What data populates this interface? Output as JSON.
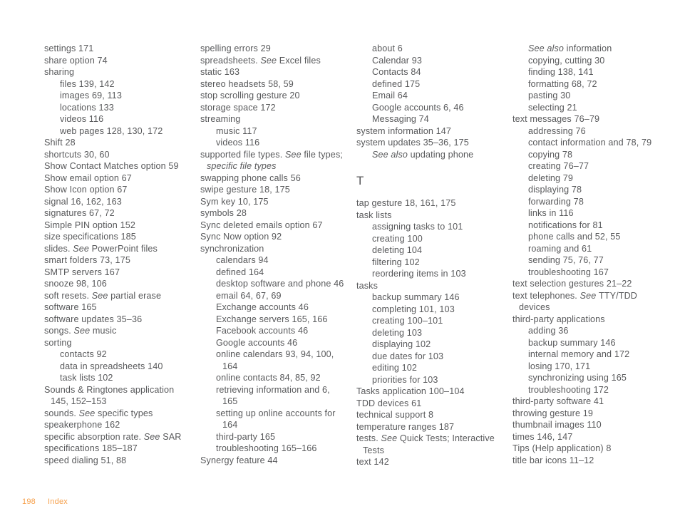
{
  "page": {
    "title": "Index",
    "folio_number": "198",
    "folio_label": "Index",
    "accent_color": "#f6a04b",
    "text_color": "#58595b",
    "background_color": "#ffffff"
  },
  "columns": [
    {
      "id": "column-1",
      "entries": [
        {
          "level": 0,
          "text": "settings 171"
        },
        {
          "level": 0,
          "text": "share option 74"
        },
        {
          "level": 0,
          "text": "sharing"
        },
        {
          "level": 1,
          "text": "files 139, 142"
        },
        {
          "level": 1,
          "text": "images 69, 113"
        },
        {
          "level": 1,
          "text": "locations 133"
        },
        {
          "level": 1,
          "text": "videos 116"
        },
        {
          "level": 1,
          "text": "web pages 128, 130, 172"
        },
        {
          "level": 0,
          "text": "Shift 28"
        },
        {
          "level": 0,
          "text": "shortcuts 30, 60"
        },
        {
          "level": 0,
          "text": "Show Contact Matches option 59"
        },
        {
          "level": 0,
          "text": "Show email option 67"
        },
        {
          "level": 0,
          "text": "Show Icon option 67"
        },
        {
          "level": 0,
          "text": "signal 16, 162, 163"
        },
        {
          "level": 0,
          "text": "signatures 67, 72"
        },
        {
          "level": 0,
          "text": "Simple PIN option 152"
        },
        {
          "level": 0,
          "text": "size specifications 185"
        },
        {
          "level": 0,
          "text": "slides. ",
          "italic_part": "See ",
          "tail": "PowerPoint files"
        },
        {
          "level": 0,
          "text": "smart folders 73, 175"
        },
        {
          "level": 0,
          "text": "SMTP servers 167"
        },
        {
          "level": 0,
          "text": "snooze 98, 106"
        },
        {
          "level": 0,
          "text": "soft resets. ",
          "italic_part": "See ",
          "tail": "partial erase"
        },
        {
          "level": 0,
          "text": "software 165"
        },
        {
          "level": 0,
          "text": "software updates 35–36"
        },
        {
          "level": 0,
          "text": "songs. ",
          "italic_part": "See ",
          "tail": "music"
        },
        {
          "level": 0,
          "text": "sorting"
        },
        {
          "level": 1,
          "text": "contacts 92"
        },
        {
          "level": 1,
          "text": "data in spreadsheets 140"
        },
        {
          "level": 1,
          "text": "task lists 102"
        },
        {
          "level": 0,
          "text": "Sounds & Ringtones application"
        },
        {
          "level": 0,
          "wrap": true,
          "text": "145, 152–153"
        },
        {
          "level": 0,
          "text": "sounds. ",
          "italic_part": "See ",
          "tail": "specific types"
        },
        {
          "level": 0,
          "text": "speakerphone 162"
        },
        {
          "level": 0,
          "text": "specific absorption rate. ",
          "italic_part": "See ",
          "tail": "SAR"
        },
        {
          "level": 0,
          "text": "specifications 185–187"
        },
        {
          "level": 0,
          "text": "speed dialing 51, 88"
        }
      ]
    },
    {
      "id": "column-2",
      "entries": [
        {
          "level": 0,
          "text": "spelling errors 29"
        },
        {
          "level": 0,
          "text": "spreadsheets. ",
          "italic_part": "See ",
          "tail": "Excel files"
        },
        {
          "level": 0,
          "text": "static 163"
        },
        {
          "level": 0,
          "text": "stereo headsets 58, 59"
        },
        {
          "level": 0,
          "text": "stop scrolling gesture 20"
        },
        {
          "level": 0,
          "text": "storage space 172"
        },
        {
          "level": 0,
          "text": "streaming"
        },
        {
          "level": 1,
          "text": "music 117"
        },
        {
          "level": 1,
          "text": "videos 116"
        },
        {
          "level": 0,
          "text": "supported file types. ",
          "italic_part": "See ",
          "tail": "file types;"
        },
        {
          "level": 0,
          "wrap": true,
          "italic_full": true,
          "text": "specific file types"
        },
        {
          "level": 0,
          "text": "swapping phone calls 56"
        },
        {
          "level": 0,
          "text": "swipe gesture 18, 175"
        },
        {
          "level": 0,
          "text": "Sym key 10, 175"
        },
        {
          "level": 0,
          "text": "symbols 28"
        },
        {
          "level": 0,
          "text": "Sync deleted emails option 67"
        },
        {
          "level": 0,
          "text": "Sync Now option 92"
        },
        {
          "level": 0,
          "text": "synchronization"
        },
        {
          "level": 1,
          "text": "calendars 94"
        },
        {
          "level": 1,
          "text": "defined 164"
        },
        {
          "level": 1,
          "text": "desktop software and phone 46"
        },
        {
          "level": 1,
          "text": "email 64, 67, 69"
        },
        {
          "level": 1,
          "text": "Exchange accounts 46"
        },
        {
          "level": 1,
          "text": "Exchange servers 165, 166"
        },
        {
          "level": 1,
          "text": "Facebook accounts 46"
        },
        {
          "level": 1,
          "text": "Google accounts 46"
        },
        {
          "level": 1,
          "text": "online calendars 93, 94, 100,"
        },
        {
          "level": 1,
          "wrap": true,
          "text": "164"
        },
        {
          "level": 1,
          "text": "online contacts 84, 85, 92"
        },
        {
          "level": 1,
          "text": "retrieving information and 6,"
        },
        {
          "level": 1,
          "wrap": true,
          "text": "165"
        },
        {
          "level": 1,
          "text": "setting up online accounts for"
        },
        {
          "level": 1,
          "wrap": true,
          "text": "164"
        },
        {
          "level": 1,
          "text": "third-party 165"
        },
        {
          "level": 1,
          "text": "troubleshooting 165–166"
        },
        {
          "level": 0,
          "text": "Synergy feature 44"
        }
      ]
    },
    {
      "id": "column-3",
      "entries": [
        {
          "level": 1,
          "text": "about 6"
        },
        {
          "level": 1,
          "text": "Calendar 93"
        },
        {
          "level": 1,
          "text": "Contacts 84"
        },
        {
          "level": 1,
          "text": "defined 175"
        },
        {
          "level": 1,
          "text": "Email 64"
        },
        {
          "level": 1,
          "text": "Google accounts 6, 46"
        },
        {
          "level": 1,
          "text": "Messaging 74"
        },
        {
          "level": 0,
          "text": "system information 147"
        },
        {
          "level": 0,
          "text": "system updates 35–36, 175"
        },
        {
          "level": 1,
          "text": "",
          "italic_part": "See also ",
          "tail": "updating phone"
        },
        {
          "heading": "T"
        },
        {
          "level": 0,
          "text": "tap gesture 18, 161, 175"
        },
        {
          "level": 0,
          "text": "task lists"
        },
        {
          "level": 1,
          "text": "assigning tasks to 101"
        },
        {
          "level": 1,
          "text": "creating 100"
        },
        {
          "level": 1,
          "text": "deleting 104"
        },
        {
          "level": 1,
          "text": "filtering 102"
        },
        {
          "level": 1,
          "text": "reordering items in 103"
        },
        {
          "level": 0,
          "text": "tasks"
        },
        {
          "level": 1,
          "text": "backup summary 146"
        },
        {
          "level": 1,
          "text": "completing 101, 103"
        },
        {
          "level": 1,
          "text": "creating 100–101"
        },
        {
          "level": 1,
          "text": "deleting 103"
        },
        {
          "level": 1,
          "text": "displaying 102"
        },
        {
          "level": 1,
          "text": "due dates for 103"
        },
        {
          "level": 1,
          "text": "editing 102"
        },
        {
          "level": 1,
          "text": "priorities for 103"
        },
        {
          "level": 0,
          "text": "Tasks application 100–104"
        },
        {
          "level": 0,
          "text": "TDD devices 61"
        },
        {
          "level": 0,
          "text": "technical support 8"
        },
        {
          "level": 0,
          "text": "temperature ranges 187"
        },
        {
          "level": 0,
          "text": "tests. ",
          "italic_part": "See ",
          "tail": "Quick Tests; Interactive"
        },
        {
          "level": 0,
          "wrap": true,
          "text": "Tests"
        },
        {
          "level": 0,
          "text": "text 142"
        }
      ]
    },
    {
      "id": "column-4",
      "entries": [
        {
          "level": 1,
          "text": "",
          "italic_part": "See also ",
          "tail": "information"
        },
        {
          "level": 1,
          "text": "copying, cutting 30"
        },
        {
          "level": 1,
          "text": "finding 138, 141"
        },
        {
          "level": 1,
          "text": "formatting 68, 72"
        },
        {
          "level": 1,
          "text": "pasting 30"
        },
        {
          "level": 1,
          "text": "selecting 21"
        },
        {
          "level": 0,
          "text": "text messages 76–79"
        },
        {
          "level": 1,
          "text": "addressing 76"
        },
        {
          "level": 1,
          "text": "contact information and 78, 79"
        },
        {
          "level": 1,
          "text": "copying 78"
        },
        {
          "level": 1,
          "text": "creating 76–77"
        },
        {
          "level": 1,
          "text": "deleting 79"
        },
        {
          "level": 1,
          "text": "displaying 78"
        },
        {
          "level": 1,
          "text": "forwarding 78"
        },
        {
          "level": 1,
          "text": "links in 116"
        },
        {
          "level": 1,
          "text": "notifications for 81"
        },
        {
          "level": 1,
          "text": "phone calls and 52, 55"
        },
        {
          "level": 1,
          "text": "roaming and 61"
        },
        {
          "level": 1,
          "text": "sending 75, 76, 77"
        },
        {
          "level": 1,
          "text": "troubleshooting 167"
        },
        {
          "level": 0,
          "text": "text selection gestures 21–22"
        },
        {
          "level": 0,
          "text": "text telephones. ",
          "italic_part": "See ",
          "tail": "TTY/TDD"
        },
        {
          "level": 0,
          "wrap": true,
          "text": "devices"
        },
        {
          "level": 0,
          "text": "third-party applications"
        },
        {
          "level": 1,
          "text": "adding 36"
        },
        {
          "level": 1,
          "text": "backup summary 146"
        },
        {
          "level": 1,
          "text": "internal memory and 172"
        },
        {
          "level": 1,
          "text": "losing 170, 171"
        },
        {
          "level": 1,
          "text": "synchronizing using 165"
        },
        {
          "level": 1,
          "text": "troubleshooting 172"
        },
        {
          "level": 0,
          "text": "third-party software 41"
        },
        {
          "level": 0,
          "text": "throwing gesture 19"
        },
        {
          "level": 0,
          "text": "thumbnail images 110"
        },
        {
          "level": 0,
          "text": "times 146, 147"
        },
        {
          "level": 0,
          "text": "Tips (Help application) 8"
        },
        {
          "level": 0,
          "text": "title bar icons 11–12"
        }
      ]
    }
  ]
}
